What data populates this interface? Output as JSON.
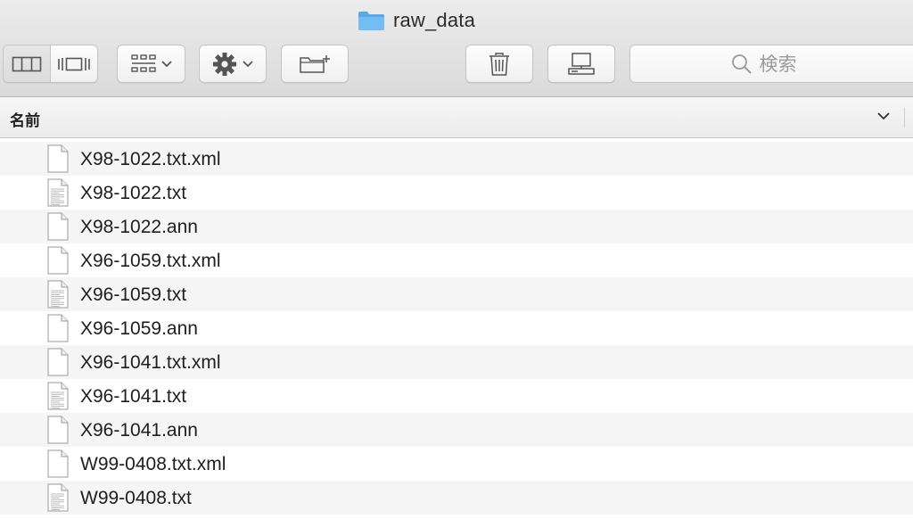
{
  "window": {
    "title": "raw_data"
  },
  "toolbar": {
    "view_columns_icon": "columns-view-icon",
    "view_coverflow_icon": "coverflow-view-icon",
    "arrange_icon": "grid-arrange-icon",
    "action_icon": "gear-icon",
    "new_folder_icon": "new-folder-icon",
    "trash_icon": "trash-icon",
    "connect_icon": "connect-server-icon"
  },
  "search": {
    "placeholder": "検索"
  },
  "column": {
    "name_header": "名前"
  },
  "files": [
    {
      "name": "X98-1022.txt.xml",
      "icon": "blank-document-icon"
    },
    {
      "name": "X98-1022.txt",
      "icon": "text-document-icon"
    },
    {
      "name": "X98-1022.ann",
      "icon": "blank-document-icon"
    },
    {
      "name": "X96-1059.txt.xml",
      "icon": "blank-document-icon"
    },
    {
      "name": "X96-1059.txt",
      "icon": "text-document-icon"
    },
    {
      "name": "X96-1059.ann",
      "icon": "blank-document-icon"
    },
    {
      "name": "X96-1041.txt.xml",
      "icon": "blank-document-icon"
    },
    {
      "name": "X96-1041.txt",
      "icon": "text-document-icon"
    },
    {
      "name": "X96-1041.ann",
      "icon": "blank-document-icon"
    },
    {
      "name": "W99-0408.txt.xml",
      "icon": "blank-document-icon"
    },
    {
      "name": "W99-0408.txt",
      "icon": "text-document-icon"
    }
  ],
  "colors": {
    "folder_blue": "#6cb6ef",
    "toolbar_bg": "#e3e3e3",
    "row_stripe": "#f5f5f5"
  }
}
